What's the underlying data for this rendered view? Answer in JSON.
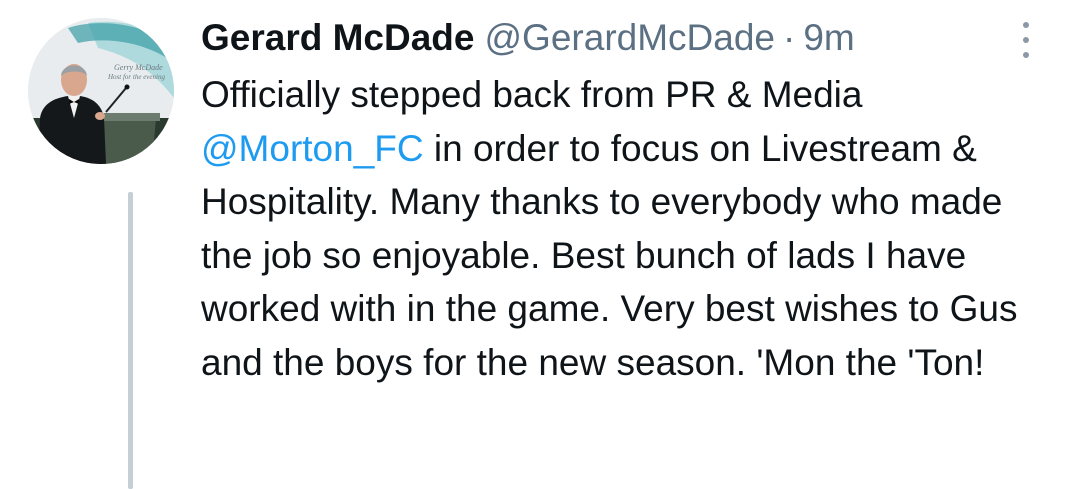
{
  "tweet": {
    "author": {
      "display_name": "Gerard McDade",
      "handle": "@GerardMcDade",
      "separator": "·",
      "time": "9m",
      "avatar_banner_lines": [
        "Gerry McDade",
        "Host for the evening"
      ]
    },
    "text": {
      "part1": "Officially stepped back from PR & Media ",
      "mention": "@Morton_FC",
      "part2": " in order to focus on Livestream & Hospitality. Many thanks to everybody who made the job so enjoyable. Best bunch of lads I have worked with in the game. Very best wishes to Gus and the boys for the new season. 'Mon the 'Ton!"
    },
    "more_icon": "more-vertical-icon"
  },
  "colors": {
    "text_primary": "#0f1419",
    "text_secondary": "#5b7083",
    "link": "#1d9bf0",
    "thread_line": "#c4cfd6",
    "background": "#ffffff"
  }
}
